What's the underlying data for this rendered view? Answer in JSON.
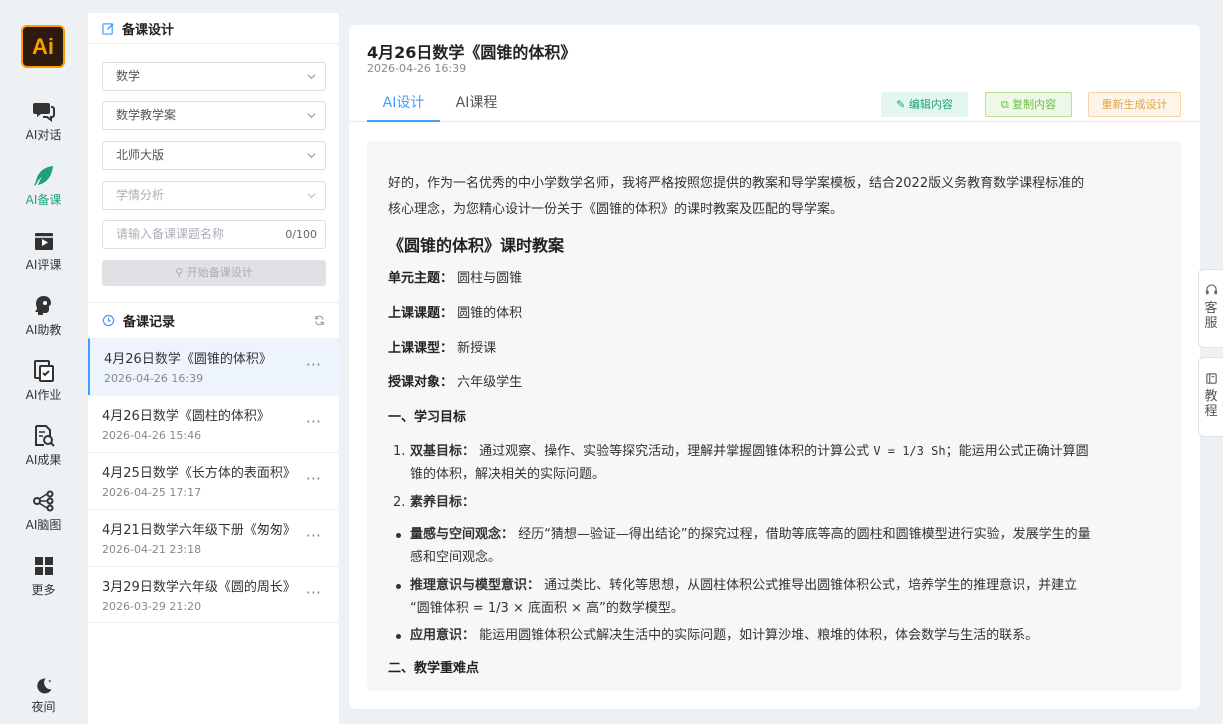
{
  "logo": {
    "text": "Ai"
  },
  "nav": [
    {
      "label": "AI对话",
      "icon": "chat-icon"
    },
    {
      "label": "AI备课",
      "icon": "feather-icon",
      "active": true
    },
    {
      "label": "AI评课",
      "icon": "clapper-icon"
    },
    {
      "label": "AI助教",
      "icon": "assistant-icon"
    },
    {
      "label": "AI作业",
      "icon": "homework-icon"
    },
    {
      "label": "AI成果",
      "icon": "search-doc-icon"
    },
    {
      "label": "AI脑图",
      "icon": "mindmap-icon"
    },
    {
      "label": "更多",
      "icon": "grid-icon"
    },
    {
      "label": "夜间",
      "icon": "moon-icon"
    }
  ],
  "prep": {
    "title": "备课设计",
    "subject": "数学",
    "doc_type": "数学教学案",
    "edition": "北师大版",
    "analysis_placeholder": "学情分析",
    "title_placeholder": "请输入备课课题名称",
    "title_count": "0/100",
    "start_label": "开始备课设计"
  },
  "records": {
    "title": "备课记录",
    "items": [
      {
        "title": "4月26日数学《圆锥的体积》",
        "date": "2026-04-26 16:39"
      },
      {
        "title": "4月26日数学《圆柱的体积》",
        "date": "2026-04-26 15:46"
      },
      {
        "title": "4月25日数学《长方体的表面积》",
        "date": "2026-04-25 17:17"
      },
      {
        "title": "4月21日数学六年级下册《匆匆》",
        "date": "2026-04-21 23:18"
      },
      {
        "title": "3月29日数学六年级《圆的周长》",
        "date": "2026-03-29 21:20"
      }
    ]
  },
  "doc": {
    "title": "4月26日数学《圆锥的体积》",
    "time": "2026-04-26 16:39",
    "tabs": [
      "AI设计",
      "AI课程"
    ],
    "buttons": {
      "edit": "编辑内容",
      "copy": "复制内容",
      "regen": "重新生成设计"
    },
    "intro_line1": "好的，作为一名优秀的中小学数学名师，我将严格按照您提供的教案和导学案模板，结合2022版义务教育数学课程标准的",
    "intro_line2": "核心理念，为您精心设计一份关于《圆锥的体积》的课时教案及匹配的导学案。",
    "heading": "《圆锥的体积》课时教案",
    "fields": [
      {
        "k": "单元主题：",
        "v": "圆柱与圆锥"
      },
      {
        "k": "上课课题：",
        "v": "圆锥的体积"
      },
      {
        "k": "上课课型：",
        "v": "新授课"
      },
      {
        "k": "授课对象：",
        "v": "六年级学生"
      }
    ],
    "section1": "一、学习目标",
    "goal1_num": "1.",
    "goal1_k": "双基目标：",
    "goal1_v1": "通过观察、操作、实验等探究活动，理解并掌握圆锥体积的计算公式",
    "goal1_formula": "V = 1/3 Sh",
    "goal1_v2": "；能运用公式正确计算圆",
    "goal1_line2": "锥的体积，解决相关的实际问题。",
    "goal2_num": "2.",
    "goal2_k": "素养目标：",
    "bullets": [
      {
        "k": "量感与空间观念：",
        "l1": "经历“猜想—验证—得出结论”的探究过程，借助等底等高的圆柱和圆锥模型进行实验，发展学生的量",
        "l2": "感和空间观念。"
      },
      {
        "k": "推理意识与模型意识：",
        "l1": "通过类比、转化等思想，从圆柱体积公式推导出圆锥体积公式，培养学生的推理意识，并建立",
        "l2": "“圆锥体积 = 1/3 × 底面积 × 高”的数学模型。"
      },
      {
        "k": "应用意识：",
        "l1": "能运用圆锥体积公式解决生活中的实际问题，如计算沙堆、粮堆的体积，体会数学与生活的联系。",
        "l2": ""
      }
    ],
    "section2": "二、教学重难点"
  },
  "float": {
    "service": [
      "客",
      "服"
    ],
    "tutorial": [
      "教",
      "程"
    ]
  }
}
